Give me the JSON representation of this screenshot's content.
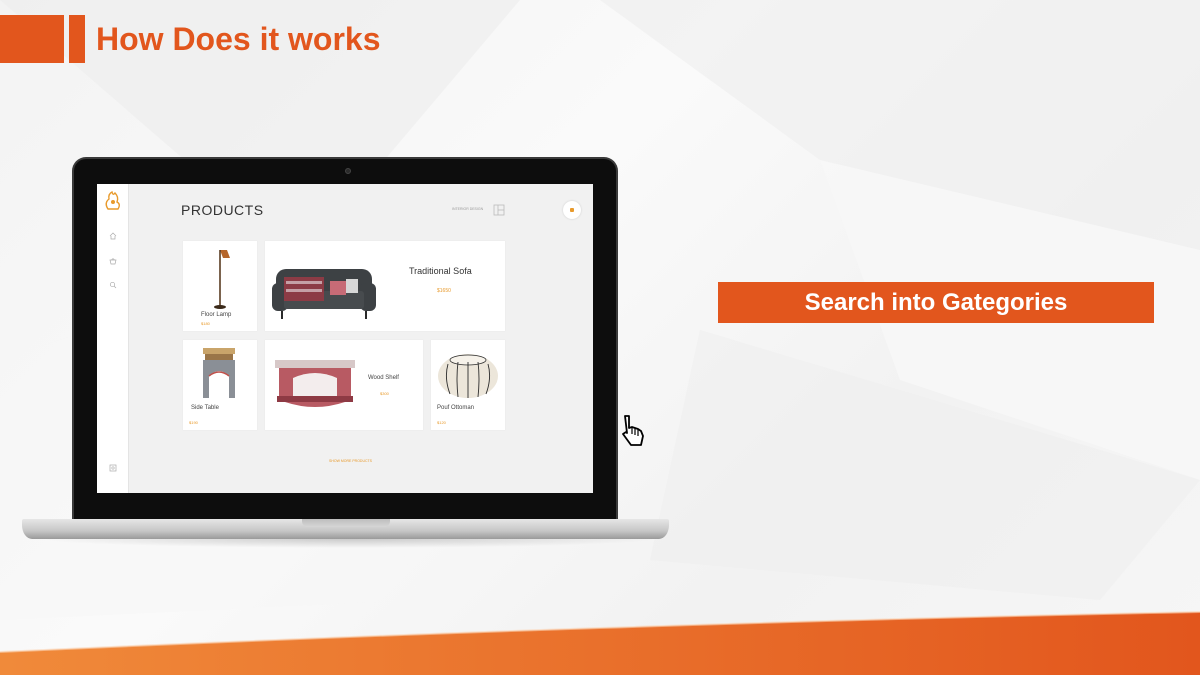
{
  "slide": {
    "title": "How Does it works",
    "callout": "Search into Gategories",
    "accent_color": "#e2561d"
  },
  "app": {
    "page_title": "PRODUCTS",
    "header_link": "INTERIOR DESIGN",
    "show_more": "SHOW MORE PRODUCTS",
    "accent_color": "#e89a2c",
    "nav_icons": [
      "home-icon",
      "basket-icon",
      "search-icon",
      "settings-icon"
    ],
    "products": [
      {
        "name": "Floor Lamp",
        "price": "$180"
      },
      {
        "name": "Traditional Sofa",
        "price": "$1650"
      },
      {
        "name": "Side Table",
        "price": "$190"
      },
      {
        "name": "Wood Shelf",
        "price": "$300"
      },
      {
        "name": "Pouf Ottoman",
        "price": "$120"
      }
    ]
  }
}
